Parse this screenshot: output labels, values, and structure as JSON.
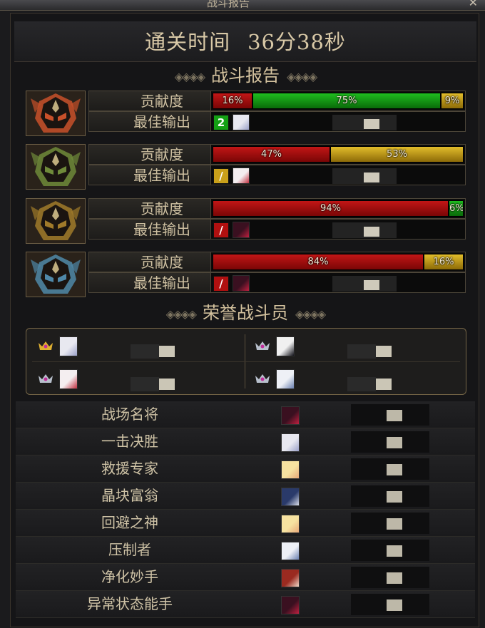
{
  "window": {
    "title": "战斗报告",
    "close_glyph": "✕"
  },
  "clear_time": {
    "label": "通关时间",
    "value": "36分38秒"
  },
  "report_heading": "战斗报告",
  "honor_heading": "荣誉战斗员",
  "decor": {
    "left": "◈◈◈◈",
    "right": "◈◈◈◈"
  },
  "players": [
    {
      "portrait": "crimson-helm-icon",
      "accent": "#c8502a",
      "contribution_label": "贡献度",
      "best_output_label": "最佳输出",
      "segments": [
        {
          "text": "16%",
          "pct": 0.16,
          "color": "red"
        },
        {
          "text": "75%",
          "pct": 0.75,
          "color": "green"
        },
        {
          "text": "9%",
          "pct": 0.09,
          "color": "gold"
        }
      ],
      "best_skill": {
        "glyph": "2",
        "color": "green"
      },
      "best_avatar": "silver-hair-avatar"
    },
    {
      "portrait": "jade-helm-icon",
      "accent": "#6f8a3a",
      "contribution_label": "贡献度",
      "best_output_label": "最佳输出",
      "segments": [
        {
          "text": "47%",
          "pct": 0.47,
          "color": "red"
        },
        {
          "text": "53%",
          "pct": 0.53,
          "color": "gold"
        }
      ],
      "best_skill": {
        "glyph": "/",
        "color": "gold"
      },
      "best_avatar": "white-hair-red-eye-avatar"
    },
    {
      "portrait": "bronze-helm-icon",
      "accent": "#a07a2a",
      "contribution_label": "贡献度",
      "best_output_label": "最佳输出",
      "segments": [
        {
          "text": "94%",
          "pct": 0.94,
          "color": "red"
        },
        {
          "text": "6%",
          "pct": 0.06,
          "color": "green"
        }
      ],
      "best_skill": {
        "glyph": "/",
        "color": "red"
      },
      "best_avatar": "dark-demon-avatar"
    },
    {
      "portrait": "azure-helm-icon",
      "accent": "#4f88a8",
      "contribution_label": "贡献度",
      "best_output_label": "最佳输出",
      "segments": [
        {
          "text": "84%",
          "pct": 0.84,
          "color": "red"
        },
        {
          "text": "16%",
          "pct": 0.16,
          "color": "gold"
        }
      ],
      "best_skill": {
        "glyph": "/",
        "color": "red"
      },
      "best_avatar": "dark-demon-avatar"
    }
  ],
  "honor": [
    {
      "crown": "gold-crown-icon",
      "avatar": "silver-hair-avatar"
    },
    {
      "crown": "silver-crown-icon",
      "avatar": "black-white-avatar"
    },
    {
      "crown": "silver-crown-icon",
      "avatar": "white-hair-red-eye-avatar"
    },
    {
      "crown": "silver-crown-icon",
      "avatar": "white-hair-avatar"
    }
  ],
  "awards": [
    {
      "name": "战场名将",
      "avatar": "dark-demon-avatar"
    },
    {
      "name": "一击决胜",
      "avatar": "silver-hair-avatar"
    },
    {
      "name": "救援专家",
      "avatar": "blonde-avatar"
    },
    {
      "name": "晶块富翁",
      "avatar": "dark-blue-hair-avatar"
    },
    {
      "name": "回避之神",
      "avatar": "blonde-avatar"
    },
    {
      "name": "压制者",
      "avatar": "white-hair-avatar"
    },
    {
      "name": "净化妙手",
      "avatar": "red-hair-avatar"
    },
    {
      "name": "异常状态能手",
      "avatar": "dark-demon-avatar"
    }
  ],
  "colors": {
    "red": "#b01010",
    "green": "#14a014",
    "gold": "#c9a01a",
    "frame": "#756546"
  }
}
